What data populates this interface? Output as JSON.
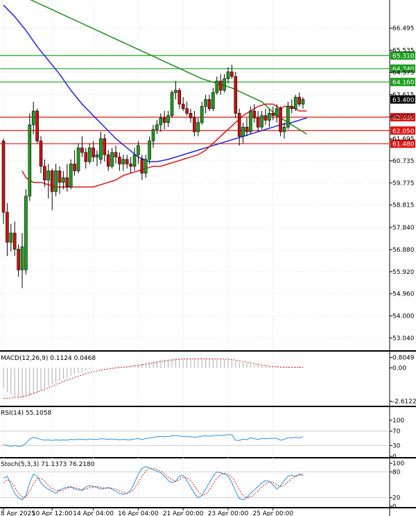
{
  "chart_data": {
    "type": "candlestick",
    "main": {
      "y_ticks": [
        "66.495",
        "65.535",
        "64.575",
        "63.615",
        "62.655",
        "61.695",
        "60.735",
        "59.775",
        "58.815",
        "57.840",
        "56.880",
        "55.920",
        "54.960",
        "54.000",
        "53.040"
      ],
      "ylim": [
        52.6,
        67.6
      ],
      "levels": [
        {
          "label": "65.310",
          "value": 65.31,
          "color": "#1e9e1e"
        },
        {
          "label": "64.740",
          "value": 64.74,
          "color": "#1e9e1e"
        },
        {
          "label": "64.160",
          "value": 64.16,
          "color": "#1e9e1e"
        },
        {
          "label": "62.630",
          "value": 62.63,
          "color": "#e01515"
        },
        {
          "label": "62.050",
          "value": 62.05,
          "color": "#e01515"
        },
        {
          "label": "61.480",
          "value": 61.48,
          "color": "#e01515"
        }
      ],
      "current_price": {
        "label": "63.400",
        "value": 63.4
      },
      "candles": [
        {
          "o": 61.6,
          "h": 61.7,
          "l": 58.0,
          "c": 58.5
        },
        {
          "o": 58.5,
          "h": 58.9,
          "l": 56.6,
          "c": 57.2
        },
        {
          "o": 57.2,
          "h": 58.0,
          "l": 56.8,
          "c": 57.6
        },
        {
          "o": 57.6,
          "h": 58.1,
          "l": 56.6,
          "c": 56.9
        },
        {
          "o": 56.9,
          "h": 57.1,
          "l": 55.7,
          "c": 56.0
        },
        {
          "o": 56.0,
          "h": 57.6,
          "l": 55.2,
          "c": 57.0
        },
        {
          "o": 56.0,
          "h": 59.5,
          "l": 55.8,
          "c": 59.2
        },
        {
          "o": 59.2,
          "h": 62.8,
          "l": 59.0,
          "c": 62.3
        },
        {
          "o": 62.3,
          "h": 63.3,
          "l": 61.9,
          "c": 62.9
        },
        {
          "o": 62.9,
          "h": 63.0,
          "l": 61.5,
          "c": 61.6
        },
        {
          "o": 61.6,
          "h": 61.8,
          "l": 60.2,
          "c": 60.5
        },
        {
          "o": 60.5,
          "h": 60.8,
          "l": 59.6,
          "c": 59.9
        },
        {
          "o": 59.9,
          "h": 60.6,
          "l": 59.1,
          "c": 60.3
        },
        {
          "o": 60.3,
          "h": 60.4,
          "l": 58.6,
          "c": 59.4
        },
        {
          "o": 59.4,
          "h": 60.6,
          "l": 59.2,
          "c": 60.3
        },
        {
          "o": 60.3,
          "h": 60.5,
          "l": 59.3,
          "c": 59.8
        },
        {
          "o": 59.8,
          "h": 60.3,
          "l": 59.5,
          "c": 60.0
        },
        {
          "o": 60.0,
          "h": 60.6,
          "l": 59.4,
          "c": 59.6
        },
        {
          "o": 59.6,
          "h": 60.8,
          "l": 59.5,
          "c": 60.6
        },
        {
          "o": 60.6,
          "h": 61.2,
          "l": 60.1,
          "c": 60.3
        },
        {
          "o": 60.3,
          "h": 61.5,
          "l": 60.2,
          "c": 61.3
        },
        {
          "o": 61.3,
          "h": 61.8,
          "l": 60.9,
          "c": 61.1
        },
        {
          "o": 61.1,
          "h": 61.3,
          "l": 60.4,
          "c": 60.7
        },
        {
          "o": 60.7,
          "h": 61.5,
          "l": 60.6,
          "c": 61.3
        },
        {
          "o": 61.3,
          "h": 61.6,
          "l": 60.7,
          "c": 60.9
        },
        {
          "o": 60.9,
          "h": 61.2,
          "l": 60.5,
          "c": 61.0
        },
        {
          "o": 60.8,
          "h": 62.0,
          "l": 60.6,
          "c": 61.7
        },
        {
          "o": 61.7,
          "h": 61.9,
          "l": 60.7,
          "c": 61.0
        },
        {
          "o": 61.0,
          "h": 61.2,
          "l": 60.3,
          "c": 60.5
        },
        {
          "o": 60.5,
          "h": 61.3,
          "l": 60.4,
          "c": 61.1
        },
        {
          "o": 61.1,
          "h": 61.4,
          "l": 60.6,
          "c": 60.9
        },
        {
          "o": 60.9,
          "h": 61.1,
          "l": 60.3,
          "c": 60.6
        },
        {
          "o": 60.6,
          "h": 61.0,
          "l": 60.3,
          "c": 60.8
        },
        {
          "o": 60.8,
          "h": 61.0,
          "l": 60.4,
          "c": 60.6
        },
        {
          "o": 60.6,
          "h": 60.9,
          "l": 60.2,
          "c": 60.5
        },
        {
          "o": 60.5,
          "h": 61.3,
          "l": 60.3,
          "c": 61.0
        },
        {
          "o": 61.0,
          "h": 61.6,
          "l": 60.6,
          "c": 61.4
        },
        {
          "o": 60.8,
          "h": 61.0,
          "l": 59.9,
          "c": 60.2
        },
        {
          "o": 60.2,
          "h": 61.0,
          "l": 60.0,
          "c": 60.8
        },
        {
          "o": 60.8,
          "h": 61.8,
          "l": 60.6,
          "c": 61.6
        },
        {
          "o": 61.6,
          "h": 62.3,
          "l": 61.3,
          "c": 62.1
        },
        {
          "o": 62.1,
          "h": 62.5,
          "l": 61.9,
          "c": 62.3
        },
        {
          "o": 62.3,
          "h": 62.8,
          "l": 62.0,
          "c": 62.6
        },
        {
          "o": 62.6,
          "h": 62.9,
          "l": 62.1,
          "c": 62.4
        },
        {
          "o": 62.4,
          "h": 62.9,
          "l": 62.2,
          "c": 62.7
        },
        {
          "o": 62.7,
          "h": 63.8,
          "l": 62.6,
          "c": 63.7
        },
        {
          "o": 63.7,
          "h": 64.2,
          "l": 63.4,
          "c": 63.8
        },
        {
          "o": 63.8,
          "h": 63.9,
          "l": 63.0,
          "c": 63.2
        },
        {
          "o": 63.2,
          "h": 63.5,
          "l": 62.9,
          "c": 63.0
        },
        {
          "o": 63.0,
          "h": 63.3,
          "l": 62.7,
          "c": 62.8
        },
        {
          "o": 62.8,
          "h": 63.0,
          "l": 62.4,
          "c": 62.6
        },
        {
          "o": 62.6,
          "h": 62.9,
          "l": 61.8,
          "c": 62.0
        },
        {
          "o": 62.0,
          "h": 62.6,
          "l": 61.8,
          "c": 62.4
        },
        {
          "o": 62.4,
          "h": 63.3,
          "l": 62.3,
          "c": 63.1
        },
        {
          "o": 63.1,
          "h": 63.6,
          "l": 62.8,
          "c": 63.4
        },
        {
          "o": 63.4,
          "h": 63.6,
          "l": 62.9,
          "c": 63.0
        },
        {
          "o": 63.0,
          "h": 63.9,
          "l": 62.9,
          "c": 63.7
        },
        {
          "o": 63.7,
          "h": 64.4,
          "l": 63.6,
          "c": 64.2
        },
        {
          "o": 64.2,
          "h": 64.5,
          "l": 63.6,
          "c": 63.8
        },
        {
          "o": 63.8,
          "h": 64.5,
          "l": 63.7,
          "c": 64.3
        },
        {
          "o": 64.3,
          "h": 64.8,
          "l": 64.1,
          "c": 64.6
        },
        {
          "o": 64.6,
          "h": 64.9,
          "l": 64.3,
          "c": 64.4
        },
        {
          "o": 64.4,
          "h": 64.6,
          "l": 62.6,
          "c": 62.8
        },
        {
          "o": 62.8,
          "h": 63.0,
          "l": 61.4,
          "c": 61.8
        },
        {
          "o": 61.8,
          "h": 62.4,
          "l": 61.5,
          "c": 62.2
        },
        {
          "o": 62.2,
          "h": 62.6,
          "l": 61.8,
          "c": 62.0
        },
        {
          "o": 62.0,
          "h": 63.1,
          "l": 61.9,
          "c": 62.9
        },
        {
          "o": 62.9,
          "h": 63.2,
          "l": 62.4,
          "c": 62.6
        },
        {
          "o": 62.6,
          "h": 62.9,
          "l": 62.0,
          "c": 62.2
        },
        {
          "o": 62.2,
          "h": 62.9,
          "l": 62.1,
          "c": 62.7
        },
        {
          "o": 62.7,
          "h": 63.0,
          "l": 62.3,
          "c": 62.5
        },
        {
          "o": 62.5,
          "h": 63.0,
          "l": 62.2,
          "c": 62.8
        },
        {
          "o": 62.8,
          "h": 63.1,
          "l": 62.5,
          "c": 62.7
        },
        {
          "o": 62.7,
          "h": 63.2,
          "l": 62.4,
          "c": 63.0
        },
        {
          "o": 63.0,
          "h": 63.1,
          "l": 61.8,
          "c": 62.0
        },
        {
          "o": 62.0,
          "h": 62.4,
          "l": 61.7,
          "c": 62.2
        },
        {
          "o": 62.2,
          "h": 63.3,
          "l": 62.1,
          "c": 63.1
        },
        {
          "o": 63.1,
          "h": 63.4,
          "l": 62.8,
          "c": 63.0
        },
        {
          "o": 63.0,
          "h": 63.6,
          "l": 62.9,
          "c": 63.5
        },
        {
          "o": 63.5,
          "h": 63.7,
          "l": 63.1,
          "c": 63.2
        },
        {
          "o": 63.2,
          "h": 63.5,
          "l": 63.0,
          "c": 63.4
        }
      ],
      "ma_fast": [
        60.3,
        60.0,
        59.8,
        59.8,
        59.7,
        59.6,
        59.6,
        59.6,
        59.6,
        59.6,
        59.6,
        59.7,
        59.8,
        59.9,
        60.1,
        60.2,
        60.3,
        60.4,
        60.5,
        60.5,
        60.6,
        60.7,
        60.8,
        60.9,
        61.0,
        61.2,
        61.5,
        61.8,
        62.1,
        62.4,
        62.7,
        62.9,
        63.1,
        63.2,
        63.2,
        63.1,
        63.0,
        63.1,
        63.1,
        63.1,
        62.9,
        62.9
      ],
      "ma_fast_x": [
        5,
        6,
        8,
        10,
        12,
        14,
        16,
        18,
        20,
        22,
        24,
        26,
        28,
        30,
        32,
        34,
        36,
        38,
        40,
        42,
        44,
        46,
        48,
        50,
        52,
        54,
        56,
        58,
        60,
        62,
        64,
        66,
        68,
        70,
        72,
        73,
        74,
        75,
        76,
        77,
        79,
        81
      ],
      "ma_mid": [
        67.5,
        67.0,
        66.4,
        65.7,
        65.1,
        64.5,
        63.8,
        63.2,
        62.7,
        62.2,
        61.7,
        61.3,
        60.9,
        60.7,
        60.7,
        60.8,
        61.0,
        61.2,
        61.4,
        61.6,
        61.8,
        62.0,
        62.2,
        62.3,
        62.4,
        62.5,
        62.6
      ],
      "ma_mid_x": [
        0,
        3,
        6,
        9,
        12,
        15,
        18,
        21,
        24,
        27,
        30,
        33,
        36,
        39,
        41,
        44,
        48,
        52,
        56,
        60,
        64,
        68,
        72,
        74,
        77,
        79,
        81
      ],
      "ma_slow": [
        67.9,
        67.6,
        67.3,
        67.0,
        66.7,
        66.4,
        66.1,
        65.8,
        65.5,
        65.2,
        64.9,
        64.6,
        64.3,
        64.1,
        63.9,
        63.6,
        63.3,
        63.0,
        62.7,
        62.5,
        62.3,
        62.1,
        61.9
      ],
      "ma_slow_x": [
        5,
        9,
        13,
        17,
        21,
        25,
        29,
        33,
        37,
        41,
        45,
        49,
        53,
        57,
        61,
        65,
        69,
        71,
        73,
        75,
        77,
        79,
        81
      ]
    },
    "x_labels": [
      {
        "label": "8 Apr 2025",
        "index": 0
      },
      {
        "label": "10 Apr 12:00",
        "index": 13
      },
      {
        "label": "14 Apr 04:00",
        "index": 24
      },
      {
        "label": "16 Apr 04:00",
        "index": 36
      },
      {
        "label": "21 Apr 00:00",
        "index": 48
      },
      {
        "label": "23 Apr 00:00",
        "index": 60
      },
      {
        "label": "25 Apr 00:00",
        "index": 72
      }
    ],
    "macd": {
      "title": "MACD(12,26,9) 0.1124 0.0468",
      "ticks": [
        "0.8049",
        "0.00",
        "-2.6122"
      ],
      "ylim": [
        -2.8,
        1.0
      ],
      "hist": [
        -1.6,
        -1.9,
        -2.1,
        -2.2,
        -2.3,
        -2.35,
        -2.3,
        -2.2,
        -2.05,
        -1.9,
        -1.75,
        -1.6,
        -1.45,
        -1.3,
        -1.15,
        -1.0,
        -0.85,
        -0.75,
        -0.6,
        -0.5,
        -0.4,
        -0.3,
        -0.2,
        -0.1,
        -0.05,
        0.0,
        0.02,
        0.03,
        0.04,
        0.05,
        0.06,
        0.08,
        0.1,
        0.12,
        0.15,
        0.2,
        0.25,
        0.3,
        0.36,
        0.42,
        0.48,
        0.55,
        0.6,
        0.65,
        0.68,
        0.7,
        0.72,
        0.73,
        0.74,
        0.74,
        0.74,
        0.73,
        0.72,
        0.71,
        0.7,
        0.7,
        0.7,
        0.7,
        0.7,
        0.69,
        0.68,
        0.62,
        0.55,
        0.48,
        0.4,
        0.34,
        0.28,
        0.22,
        0.18,
        0.14,
        0.12,
        0.11,
        0.11,
        0.11,
        0.1,
        0.11,
        0.11,
        0.11,
        0.11,
        0.11,
        0.11
      ],
      "signal": [
        -2.4,
        -2.4,
        -2.35,
        -2.3,
        -2.3,
        -2.25,
        -2.2,
        -2.1,
        -2.0,
        -1.9,
        -1.8,
        -1.7,
        -1.55,
        -1.45,
        -1.3,
        -1.2,
        -1.05,
        -0.95,
        -0.85,
        -0.75,
        -0.65,
        -0.55,
        -0.45,
        -0.38,
        -0.3,
        -0.24,
        -0.18,
        -0.12,
        -0.08,
        -0.04,
        0.0,
        0.03,
        0.06,
        0.09,
        0.12,
        0.16,
        0.2,
        0.25,
        0.3,
        0.35,
        0.4,
        0.45,
        0.5,
        0.55,
        0.58,
        0.62,
        0.65,
        0.67,
        0.69,
        0.7,
        0.71,
        0.71,
        0.71,
        0.71,
        0.71,
        0.7,
        0.7,
        0.7,
        0.7,
        0.69,
        0.68,
        0.65,
        0.61,
        0.56,
        0.5,
        0.44,
        0.38,
        0.32,
        0.26,
        0.21,
        0.17,
        0.13,
        0.1,
        0.08,
        0.06,
        0.05,
        0.05,
        0.05,
        0.05,
        0.05,
        0.05
      ]
    },
    "rsi": {
      "title": "RSI(14) 55.1058",
      "ticks": [
        "100",
        "70",
        "30",
        "0"
      ],
      "ylim": [
        0,
        100
      ],
      "levels": [
        70,
        30
      ],
      "values": [
        32,
        30,
        28,
        30,
        28,
        29,
        36,
        48,
        53,
        50,
        47,
        45,
        46,
        44,
        46,
        45,
        46,
        45,
        47,
        46,
        48,
        47,
        46,
        48,
        47,
        47,
        49,
        48,
        47,
        48,
        47,
        46,
        47,
        46,
        46,
        48,
        49,
        47,
        49,
        51,
        53,
        54,
        55,
        54,
        55,
        57,
        58,
        56,
        55,
        55,
        54,
        53,
        54,
        56,
        57,
        56,
        57,
        59,
        58,
        59,
        60,
        60,
        45,
        44,
        48,
        46,
        52,
        49,
        47,
        50,
        49,
        50,
        50,
        50,
        45,
        47,
        52,
        51,
        53,
        51,
        55
      ]
    },
    "stoch": {
      "title": "Stoch(5,3,3) 71.1373 76.2180",
      "ticks": [
        "100",
        "80",
        "20",
        "0"
      ],
      "ylim": [
        0,
        100
      ],
      "levels": [
        80,
        20
      ],
      "k": [
        65,
        70,
        50,
        30,
        20,
        15,
        25,
        55,
        75,
        70,
        55,
        45,
        40,
        35,
        30,
        38,
        42,
        44,
        46,
        40,
        38,
        37,
        45,
        48,
        46,
        44,
        40,
        42,
        44,
        40,
        35,
        30,
        28,
        30,
        38,
        55,
        75,
        88,
        92,
        90,
        85,
        82,
        78,
        70,
        60,
        55,
        58,
        70,
        72,
        60,
        45,
        30,
        20,
        25,
        40,
        55,
        70,
        80,
        78,
        75,
        70,
        55,
        35,
        18,
        15,
        20,
        30,
        38,
        46,
        55,
        60,
        58,
        50,
        40,
        48,
        60,
        70,
        72,
        70,
        75,
        71
      ],
      "d": [
        55,
        62,
        58,
        45,
        30,
        22,
        22,
        35,
        52,
        65,
        65,
        58,
        48,
        42,
        37,
        36,
        38,
        42,
        44,
        43,
        41,
        39,
        40,
        43,
        45,
        46,
        44,
        42,
        42,
        42,
        40,
        36,
        32,
        30,
        33,
        41,
        55,
        70,
        82,
        88,
        88,
        86,
        82,
        76,
        68,
        62,
        58,
        62,
        67,
        66,
        60,
        48,
        35,
        25,
        28,
        38,
        52,
        66,
        74,
        77,
        75,
        68,
        55,
        38,
        25,
        20,
        22,
        28,
        36,
        45,
        52,
        57,
        56,
        50,
        46,
        49,
        57,
        65,
        70,
        72,
        76
      ]
    }
  }
}
